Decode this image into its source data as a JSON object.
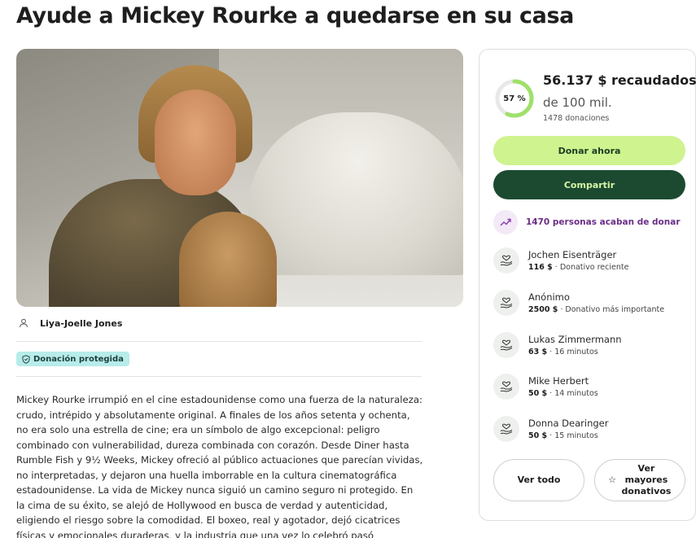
{
  "page": {
    "title": "Ayude a Mickey Rourke a quedarse en su casa"
  },
  "hero": {
    "prev_icon": "arrow-left-icon",
    "next_icon": "arrow-right-icon"
  },
  "organizer": {
    "name": "Liya-Joelle Jones",
    "icon": "person-icon"
  },
  "badge": {
    "label": "Donación protegida",
    "icon": "shield-icon",
    "color": "#b7ecea"
  },
  "story": {
    "text": "Mickey Rourke irrumpió en el cine estadounidense como una fuerza de la naturaleza: crudo, intrépido y absolutamente original. A finales de los años setenta y ochenta, no era solo una estrella de cine; era un símbolo de algo excepcional: peligro combinado con vulnerabilidad, dureza combinada con corazón. Desde Diner hasta Rumble Fish y 9½ Weeks, Mickey ofreció al público actuaciones que parecían vividas, no interpretadas, y dejaron una huella imborrable en la cultura cinematográfica estadounidense. La vida de Mickey nunca siguió un camino seguro ni protegido. En la cima de su éxito, se alejó de Hollywood en busca de verdad y autenticidad, eligiendo el riesgo sobre la comodidad. El boxeo, real y agotador, dejó cicatrices físicas y emocionales duraderas, y la industria que una vez lo celebró pasó rápidamente a otra cosa. Lo que siguió fueron años de lucha no"
  },
  "fundraiser": {
    "progress_percent": 57,
    "progress_label": "57 %",
    "raised": "56.137 $ recaudados",
    "goal": "de 100 mil.",
    "donations": "1478 donaciones",
    "donate_label": "Donar ahora",
    "share_label": "Compartir",
    "recent_text": "1470 personas acaban de donar",
    "recent_icon": "trending-up-icon",
    "accent_color": "#6a2e86",
    "ring_color": "#9fe06a",
    "donors": [
      {
        "name": "Jochen Eisenträger",
        "amount": "116 $",
        "detail": "· Donativo reciente"
      },
      {
        "name": "Anónimo",
        "amount": "2500 $",
        "detail": "· Donativo más importante"
      },
      {
        "name": "Lukas Zimmermann",
        "amount": "63 $",
        "detail": "· 16 minutos"
      },
      {
        "name": "Mike Herbert",
        "amount": "50 $",
        "detail": "· 14 minutos"
      },
      {
        "name": "Donna Dearinger",
        "amount": "50 $",
        "detail": "· 15 minutos"
      }
    ],
    "donor_icon": "heart-hand-icon",
    "see_all_label": "Ver todo",
    "top_label": "Ver mayores donativos",
    "top_icon": "star-icon"
  }
}
